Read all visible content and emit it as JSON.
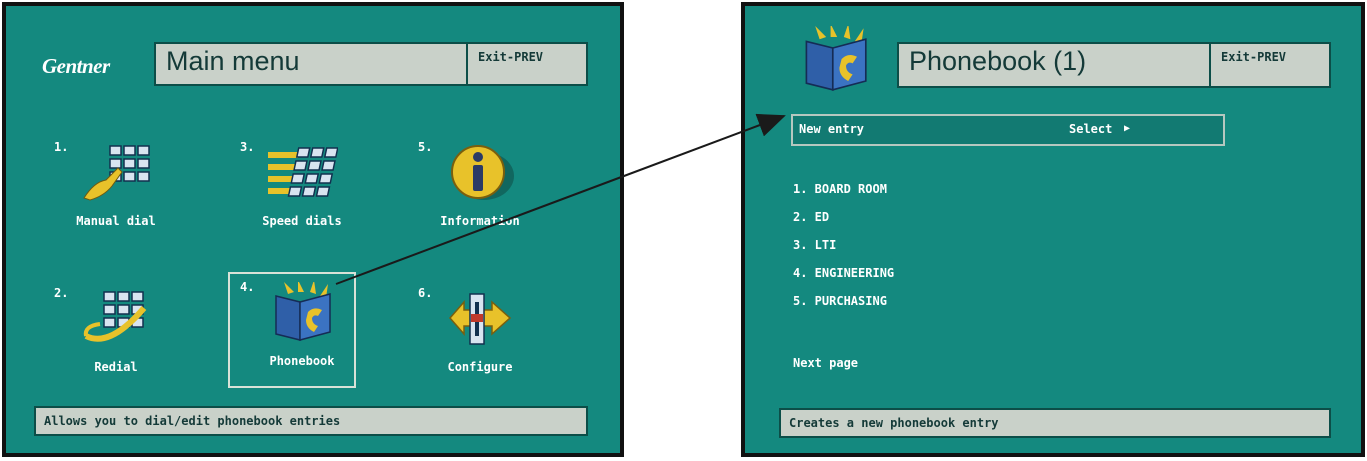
{
  "main_menu": {
    "brand": "Gentner",
    "title": "Main menu",
    "exit_label": "Exit-PREV",
    "tiles": [
      {
        "number": "1.",
        "label": "Manual dial",
        "icon": "keypad-hand-icon"
      },
      {
        "number": "3.",
        "label": "Speed dials",
        "icon": "speed-keypad-icon"
      },
      {
        "number": "5.",
        "label": "Information",
        "icon": "info-icon"
      },
      {
        "number": "2.",
        "label": "Redial",
        "icon": "redial-icon"
      },
      {
        "number": "4.",
        "label": "Phonebook",
        "icon": "phonebook-icon",
        "selected": true
      },
      {
        "number": "6.",
        "label": "Configure",
        "icon": "configure-icon"
      }
    ],
    "status": "Allows you to dial/edit phonebook entries"
  },
  "phonebook": {
    "title": "Phonebook (1)",
    "exit_label": "Exit-PREV",
    "new_entry": {
      "label": "New entry",
      "action": "Select"
    },
    "entries": [
      "1. BOARD ROOM",
      "2. ED",
      "3. LTI",
      "4. ENGINEERING",
      "5. PURCHASING"
    ],
    "next_page": "Next page",
    "status": "Creates a new phonebook entry"
  },
  "colors": {
    "screen_bg": "#14897f",
    "bar_bg": "#c9d1c9",
    "text_light": "#ffffff",
    "icon_gold": "#e8c22a",
    "icon_blue": "#2f5fa8"
  }
}
